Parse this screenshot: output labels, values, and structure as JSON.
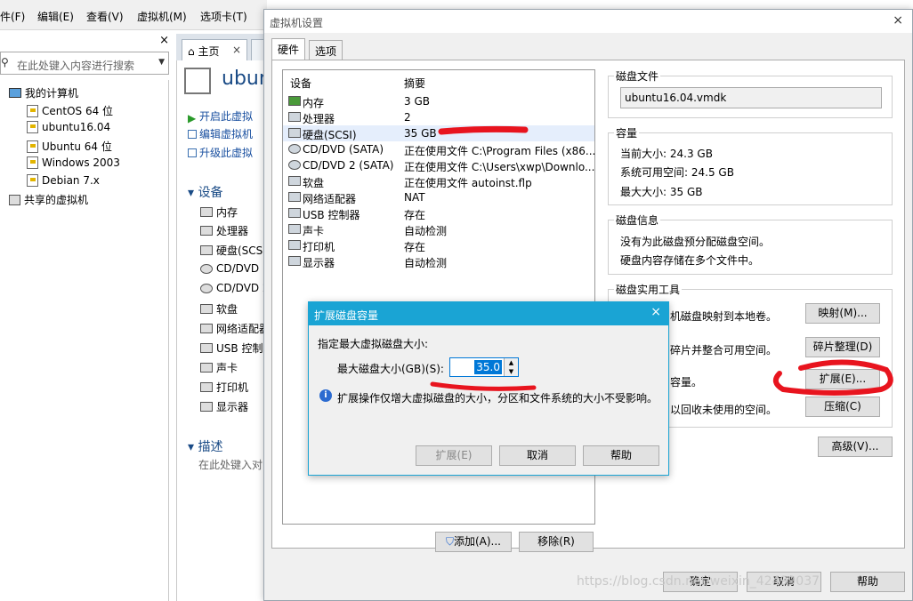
{
  "menubar": {
    "items": [
      "件(F)",
      "编辑(E)",
      "查看(V)",
      "虚拟机(M)",
      "选项卡(T)"
    ]
  },
  "library": {
    "close": "×",
    "search_placeholder": "在此处键入内容进行搜索",
    "root": "我的计算机",
    "vms": [
      "CentOS 64 位",
      "ubuntu16.04",
      "Ubuntu 64 位",
      "Windows 2003",
      "Debian 7.x"
    ],
    "shared": "共享的虚拟机"
  },
  "tabs": {
    "home": "主页",
    "close": "×"
  },
  "vm_panel": {
    "title": "ubun",
    "actions": [
      "开启此虚拟",
      "编辑虚拟机",
      "升级此虚拟"
    ],
    "devices_header": "设备",
    "devices": [
      "内存",
      "处理器",
      "硬盘(SCSI",
      "CD/DVD",
      "CD/DVD 2",
      "软盘",
      "网络适配器",
      "USB 控制",
      "声卡",
      "打印机",
      "显示器"
    ],
    "desc_header": "描述",
    "desc_placeholder": "在此处键入对"
  },
  "settings_dialog": {
    "title": "虚拟机设置",
    "close": "×",
    "tabs": [
      "硬件",
      "选项"
    ],
    "col_device": "设备",
    "col_summary": "摘要",
    "devices": [
      {
        "name": "内存",
        "summary": "3 GB"
      },
      {
        "name": "处理器",
        "summary": "2"
      },
      {
        "name": "硬盘(SCSI)",
        "summary": "35 GB"
      },
      {
        "name": "CD/DVD (SATA)",
        "summary": "正在使用文件 C:\\Program Files (x86..."
      },
      {
        "name": "CD/DVD 2 (SATA)",
        "summary": "正在使用文件 C:\\Users\\xwp\\Downlo..."
      },
      {
        "name": "软盘",
        "summary": "正在使用文件 autoinst.flp"
      },
      {
        "name": "网络适配器",
        "summary": "NAT"
      },
      {
        "name": "USB 控制器",
        "summary": "存在"
      },
      {
        "name": "声卡",
        "summary": "自动检测"
      },
      {
        "name": "打印机",
        "summary": "存在"
      },
      {
        "name": "显示器",
        "summary": "自动检测"
      }
    ],
    "add_button": "添加(A)...",
    "remove_button": "移除(R)",
    "disk_file": {
      "title": "磁盘文件",
      "value": "ubuntu16.04.vmdk"
    },
    "capacity": {
      "title": "容量",
      "current": "当前大小: 24.3 GB",
      "free": "系统可用空间: 24.5 GB",
      "max": "最大大小: 35 GB"
    },
    "disk_info": {
      "title": "磁盘信息",
      "line1": "没有为此磁盘预分配磁盘空间。",
      "line2": "硬盘内容存储在多个文件中。"
    },
    "utilities": {
      "title": "磁盘实用工具",
      "map_text": "机磁盘映射到本地卷。",
      "map_button": "映射(M)...",
      "defrag_text": "碎片并整合可用空间。",
      "defrag_button": "碎片整理(D)",
      "expand_text": "容量。",
      "expand_button": "扩展(E)...",
      "compact_text": "以回收未使用的空间。",
      "compact_button": "压缩(C)"
    },
    "advanced_button": "高级(V)...",
    "ok_button": "确定",
    "cancel_button": "取消",
    "help_button": "帮助"
  },
  "expand_dialog": {
    "title": "扩展磁盘容量",
    "close": "×",
    "prompt": "指定最大虚拟磁盘大小:",
    "label": "最大磁盘大小(GB)(S):",
    "value": "35.0",
    "info": "扩展操作仅增大虚拟磁盘的大小，分区和文件系统的大小不受影响。",
    "expand_button": "扩展(E)",
    "cancel_button": "取消",
    "help_button": "帮助"
  },
  "watermark": "https://blog.csdn.net/weixin_42499037",
  "colors": {
    "accent": "#1aa4d4",
    "annotation": "#e8141e",
    "link": "#1a50a0"
  }
}
